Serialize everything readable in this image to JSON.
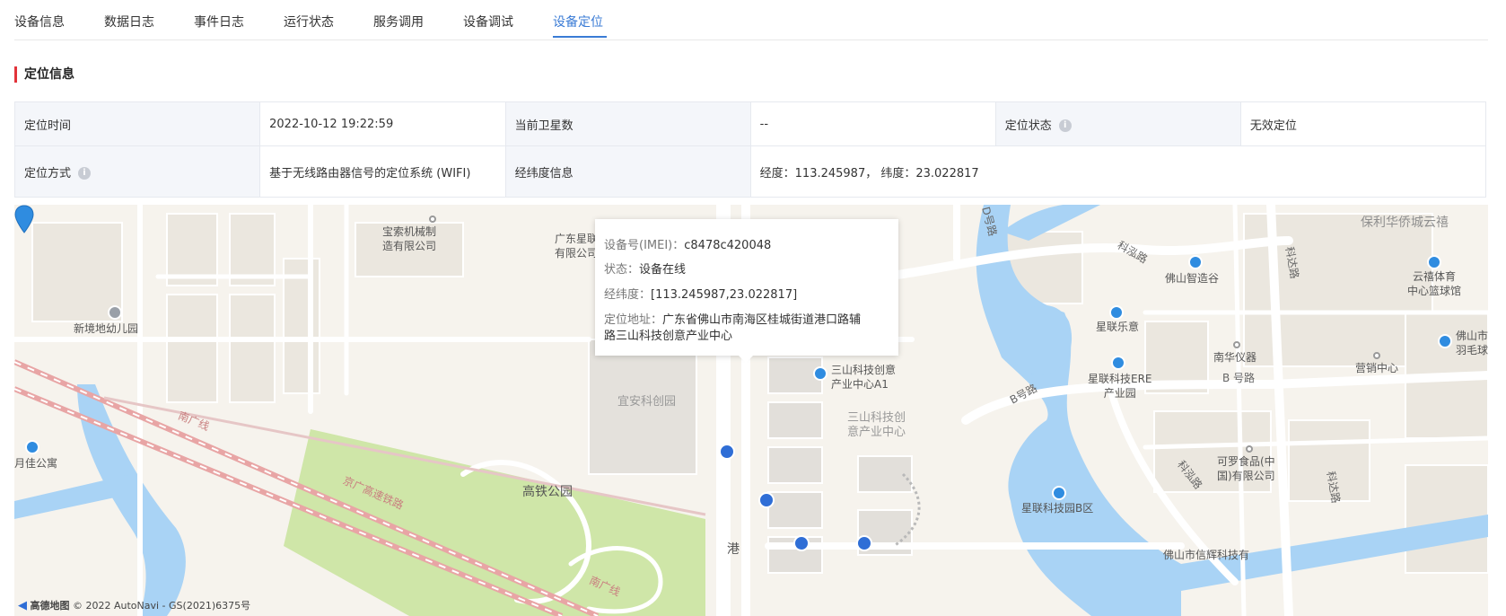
{
  "tabs": [
    {
      "label": "设备信息"
    },
    {
      "label": "数据日志"
    },
    {
      "label": "事件日志"
    },
    {
      "label": "运行状态"
    },
    {
      "label": "服务调用"
    },
    {
      "label": "设备调试"
    },
    {
      "label": "设备定位",
      "active": true
    }
  ],
  "section": {
    "title": "定位信息"
  },
  "info": {
    "time_label": "定位时间",
    "time_value": "2022-10-12 19:22:59",
    "satellite_label": "当前卫星数",
    "satellite_value": "--",
    "status_label": "定位状态",
    "status_value": "无效定位",
    "method_label": "定位方式",
    "method_value": "基于无线路由器信号的定位系统 (WIFI)",
    "lnglat_label": "经纬度信息",
    "lnglat_value": "经度：113.245987， 纬度：23.022817",
    "info_icon": "i"
  },
  "popup": {
    "imei_label": "设备号(IMEI)：",
    "imei_value": "c8478c420048",
    "state_label": "状态：",
    "state_value": "设备在线",
    "coord_label": "经纬度：",
    "coord_value": "[113.245987,23.022817]",
    "addr_label": "定位地址：",
    "addr_value_1": "广东省佛山市南海区桂城街道港口路辅",
    "addr_value_2": "路三山科技创意产业中心"
  },
  "map": {
    "pois": {
      "p1a": "宝索机械制",
      "p1b": "造有限公司",
      "p2a": "广东星联",
      "p2b": "有限公司",
      "p3": "新境地幼儿园",
      "p4": "佛山智造谷",
      "p5a": "保利华侨城云禧",
      "p6a": "云禧体育",
      "p6b": "中心篮球馆",
      "p7": "星联乐意",
      "p8": "南华仪器",
      "p9": "营销中心",
      "p10a": "佛山市林",
      "p10b": "羽毛球馆",
      "p11a": "三山科技创意",
      "p11b": "产业中心A1",
      "p12": "宜安科创园",
      "p13a": "三山科技创",
      "p13b": "意产业中心",
      "p14a": "星联科技ERE",
      "p14b": "产业园",
      "p15a": "可罗食品(中",
      "p15b": "国)有限公司",
      "p16": "星联科技园B区",
      "p17": "高铁公园",
      "p18": "月佳公寓",
      "p19": "佛山市信辉科技有",
      "p20": "港"
    },
    "roads": {
      "r1": "D号路",
      "r2": "科泓路",
      "r3": "科达路",
      "r4": "B 号路",
      "r5": "B号路",
      "r6": "南广线",
      "r7": "京广高速铁路",
      "r8": "科泓路",
      "r9": "科达路",
      "r10": "南广线"
    },
    "footer_brand": "高德地图",
    "footer_copy": "© 2022 AutoNavi - GS(2021)6375号"
  }
}
